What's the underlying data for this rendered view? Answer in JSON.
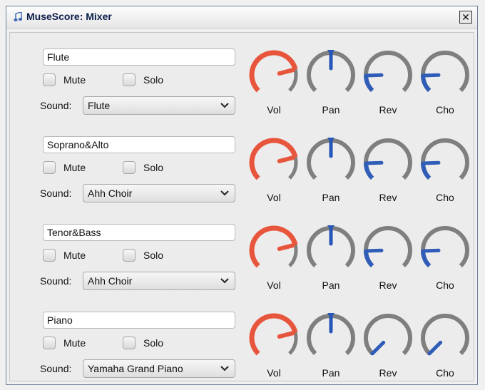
{
  "window": {
    "title": "MuseScore: Mixer",
    "close_label": "✕"
  },
  "colors": {
    "volume": "#e8553d",
    "arc": "#7f7f7f",
    "pointer": "#2f5db7",
    "pan_pointer": "#2656b8"
  },
  "knob_labels": {
    "vol": "Vol",
    "pan": "Pan",
    "rev": "Rev",
    "cho": "Cho"
  },
  "check_labels": {
    "mute": "Mute",
    "solo": "Solo"
  },
  "sound_label": "Sound:",
  "channels": [
    {
      "name": "Flute",
      "sound": "Flute",
      "mute": false,
      "solo": false,
      "vol": 0.78,
      "pan": 0.5,
      "rev": 0.16,
      "cho": 0.16
    },
    {
      "name": "Soprano&Alto",
      "sound": "Ahh Choir",
      "mute": false,
      "solo": false,
      "vol": 0.78,
      "pan": 0.5,
      "rev": 0.16,
      "cho": 0.16
    },
    {
      "name": "Tenor&Bass",
      "sound": "Ahh Choir",
      "mute": false,
      "solo": false,
      "vol": 0.78,
      "pan": 0.5,
      "rev": 0.16,
      "cho": 0.16
    },
    {
      "name": "Piano",
      "sound": "Yamaha Grand Piano",
      "mute": false,
      "solo": false,
      "vol": 0.78,
      "pan": 0.5,
      "rev": 0.0,
      "cho": 0.0
    }
  ]
}
